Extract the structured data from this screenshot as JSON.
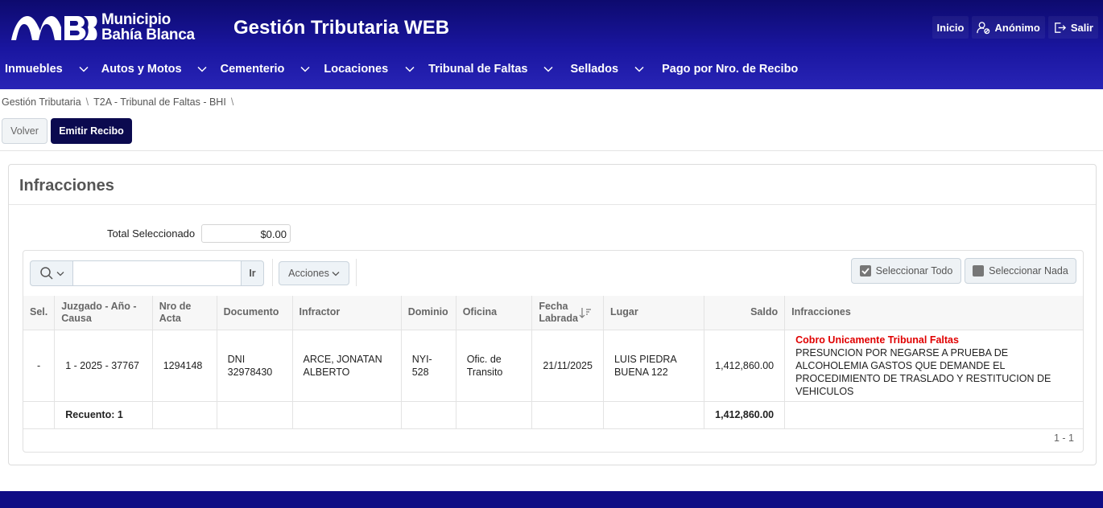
{
  "header": {
    "logo_line1": "Municipio",
    "logo_line2": "Bahía Blanca",
    "app_title": "Gestión Tributaria WEB",
    "actions": {
      "inicio": "Inicio",
      "user": "Anónimo",
      "salir": "Salir"
    }
  },
  "nav": [
    {
      "label": "Inmuebles",
      "dropdown": true
    },
    {
      "label": "Autos y Motos",
      "dropdown": true
    },
    {
      "label": "Cementerio",
      "dropdown": true
    },
    {
      "label": "Locaciones",
      "dropdown": true
    },
    {
      "label": "Tribunal de Faltas",
      "dropdown": true
    },
    {
      "label": "Sellados",
      "dropdown": true
    },
    {
      "label": "Pago por Nro. de Recibo",
      "dropdown": false
    }
  ],
  "breadcrumb": [
    "Gestión Tributaria",
    "T2A - Tribunal de Faltas - BHI"
  ],
  "buttons": {
    "volver": "Volver",
    "emitir": "Emitir Recibo"
  },
  "card": {
    "title": "Infracciones",
    "total_label": "Total Seleccionado",
    "total_value": "$0.00"
  },
  "toolbar": {
    "search_value": "",
    "go": "Ir",
    "acciones": "Acciones",
    "select_all": "Seleccionar Todo",
    "select_none": "Seleccionar Nada"
  },
  "table": {
    "headers": {
      "sel": "Sel.",
      "juzgado": "Juzgado - Año - Causa",
      "acta": "Nro de Acta",
      "documento": "Documento",
      "infractor": "Infractor",
      "dominio": "Dominio",
      "oficina": "Oficina",
      "fecha": "Fecha Labrada",
      "lugar": "Lugar",
      "saldo": "Saldo",
      "infracciones": "Infracciones"
    },
    "row": {
      "sel": "-",
      "juzgado": "1 - 2025 - 37767",
      "acta": "1294148",
      "documento": "DNI 32978430",
      "infractor": "ARCE, JONATAN ALBERTO",
      "dominio": "NYI-528",
      "oficina": "Ofic. de Transito",
      "fecha": "21/11/2025",
      "lugar": "LUIS PIEDRA BUENA 122",
      "saldo": "1,412,860.00",
      "infraccion_note": "Cobro Unicamente Tribunal Faltas",
      "infraccion_text": "PRESUNCION POR NEGARSE A PRUEBA DE ALCOHOLEMIA GASTOS QUE DEMANDE EL PROCEDIMIENTO DE TRASLADO Y RESTITUCION DE VEHICULOS"
    },
    "summary": {
      "label": "Recuento: 1",
      "saldo": "1,412,860.00"
    },
    "pagination": "1 - 1"
  },
  "colors": {
    "header": "#1a16a0",
    "primary_button": "#0b0a4f",
    "note": "#e00000"
  }
}
